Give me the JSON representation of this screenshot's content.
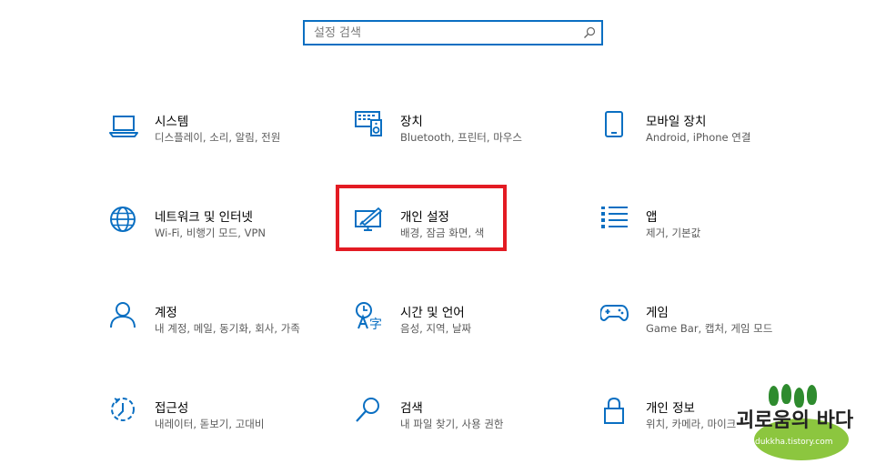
{
  "search": {
    "placeholder": "설정 검색",
    "icon": "search-icon"
  },
  "tiles": [
    {
      "title": "시스템",
      "desc": "디스플레이, 소리, 알림, 전원",
      "icon": "laptop-icon"
    },
    {
      "title": "장치",
      "desc": "Bluetooth, 프린터, 마우스",
      "icon": "keyboard-speaker-icon"
    },
    {
      "title": "모바일 장치",
      "desc": "Android, iPhone 연결",
      "icon": "phone-icon"
    },
    {
      "title": "네트워크 및 인터넷",
      "desc": "Wi-Fi, 비행기 모드, VPN",
      "icon": "globe-icon"
    },
    {
      "title": "개인 설정",
      "desc": "배경, 잠금 화면, 색",
      "icon": "pen-display-icon"
    },
    {
      "title": "앱",
      "desc": "제거, 기본값",
      "icon": "apps-list-icon"
    },
    {
      "title": "계정",
      "desc": "내 계정, 메일, 동기화, 회사, 가족",
      "icon": "person-icon"
    },
    {
      "title": "시간 및 언어",
      "desc": "음성, 지역, 날짜",
      "icon": "time-language-icon"
    },
    {
      "title": "게임",
      "desc": "Game Bar, 캡처, 게임 모드",
      "icon": "gamepad-icon"
    },
    {
      "title": "접근성",
      "desc": "내레이터, 돋보기, 고대비",
      "icon": "ease-of-access-icon"
    },
    {
      "title": "검색",
      "desc": "내 파일 찾기, 사용 권한",
      "icon": "search-icon"
    },
    {
      "title": "개인 정보",
      "desc": "위치, 카메라, 마이크",
      "icon": "lock-icon"
    }
  ],
  "watermark": {
    "title": "괴로움의 바다",
    "url": "dukkha.tistory.com"
  },
  "colors": {
    "accent": "#0a6fc2",
    "highlight": "#e31b23",
    "watermark_green": "#8cc63f"
  }
}
